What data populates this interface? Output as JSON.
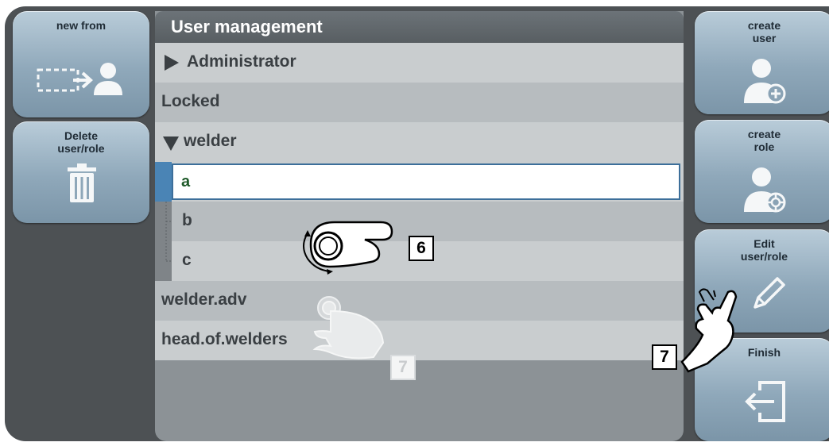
{
  "left_buttons": {
    "new_from": "new from",
    "delete": "Delete\nuser/role"
  },
  "right_buttons": {
    "create_user": "create\nuser",
    "create_role": "create\nrole",
    "edit": "Edit\nuser/role",
    "finish": "Finish"
  },
  "panel": {
    "title": "User management",
    "rows": [
      {
        "label": "Administrator",
        "expander": "collapsed"
      },
      {
        "label": "Locked"
      },
      {
        "label": "welder",
        "expander": "expanded"
      },
      {
        "label": "a",
        "selected": true
      },
      {
        "label": "b"
      },
      {
        "label": "c"
      },
      {
        "label": "welder.adv"
      },
      {
        "label": "head.of.welders"
      }
    ]
  },
  "callouts": {
    "knob": "6",
    "tap_list": "7",
    "tap_edit": "7"
  }
}
